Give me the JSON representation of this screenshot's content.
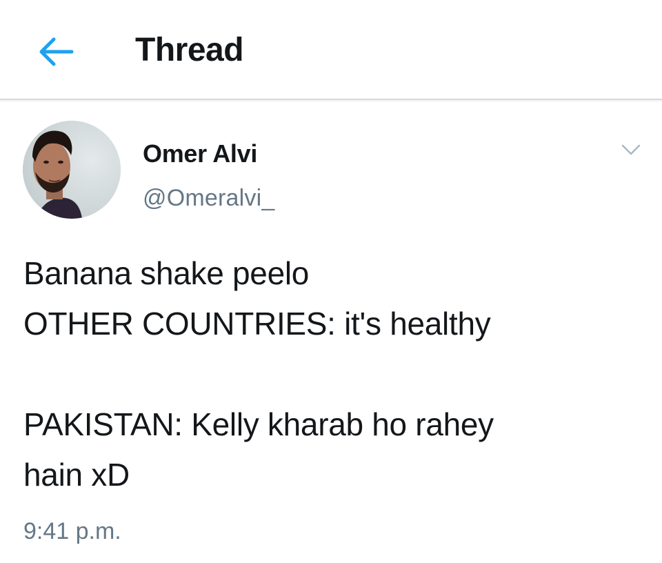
{
  "header": {
    "back_icon": "arrow-left-icon",
    "title": "Thread",
    "accent_color": "#1da1f2"
  },
  "tweet": {
    "author": {
      "name": "Omer Alvi",
      "handle": "@Omeralvi_",
      "avatar_icon": "avatar"
    },
    "menu_icon": "chevron-down-icon",
    "text_lines": [
      "Banana shake peelo",
      "OTHER COUNTRIES: it's healthy",
      "",
      "PAKISTAN: Kelly kharab ho rahey",
      "hain xD"
    ],
    "timestamp": "9:41 p.m."
  },
  "colors": {
    "text_primary": "#14171a",
    "text_secondary": "#657786",
    "divider": "#d6d9dc"
  }
}
